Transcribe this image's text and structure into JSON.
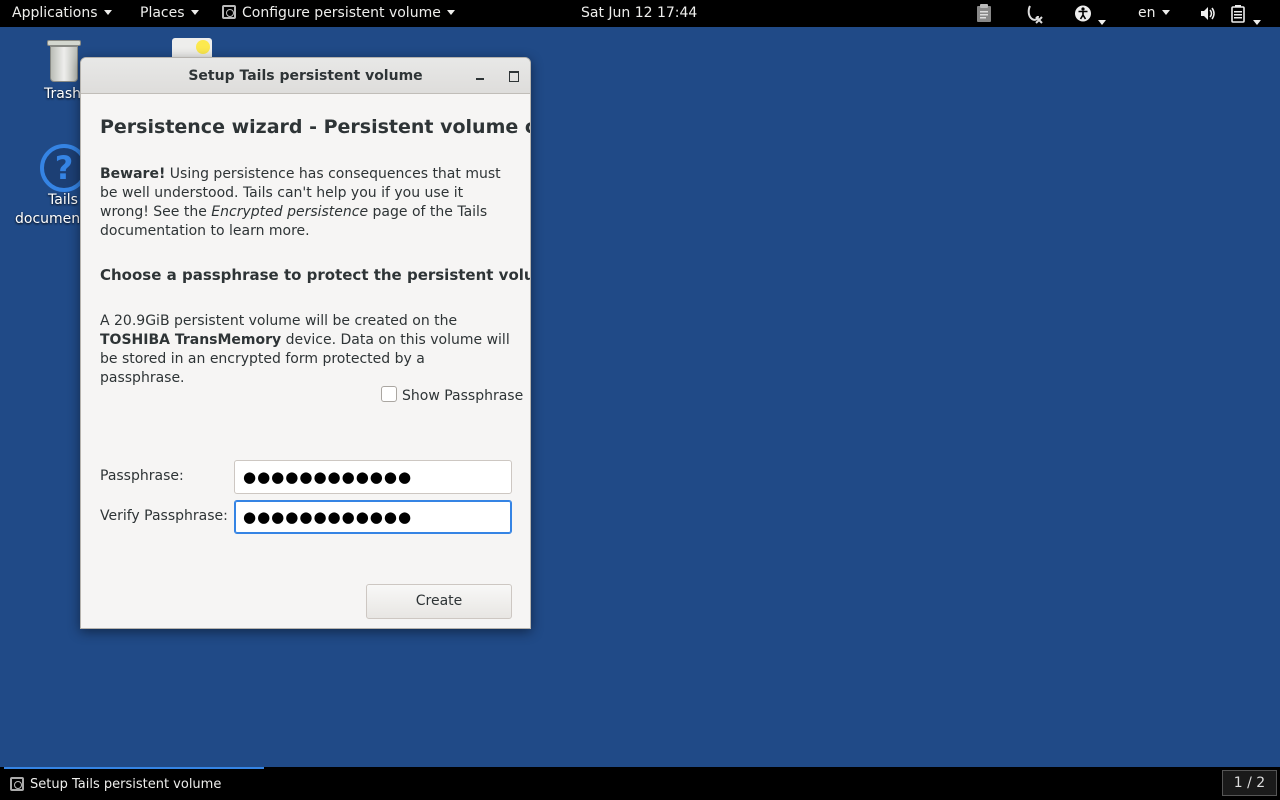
{
  "topbar": {
    "applications": "Applications",
    "places": "Places",
    "active_app": "Configure persistent volume",
    "datetime": "Sat Jun 12  17:44",
    "language": "en"
  },
  "desktop": {
    "trash_label": "Trash",
    "help_label_line1": "Tails",
    "help_label_line2": "documentation"
  },
  "window": {
    "title": "Setup Tails persistent volume",
    "heading": "Persistence wizard - Persistent volume creation",
    "warning_bold": "Beware!",
    "warning_text1": " Using persistence has consequences that must be well understood. Tails can't help you if you use it wrong! See the ",
    "warning_italic": "Encrypted persistence",
    "warning_text2": " page of the Tails documentation to learn more.",
    "subheading": "Choose a passphrase to protect the persistent volume",
    "desc_text1": "A 20.9GiB persistent volume will be created on the ",
    "desc_device": "TOSHIBA TransMemory",
    "desc_text2": " device. Data on this volume will be stored in an encrypted form protected by a passphrase.",
    "show_passphrase_label": "Show Passphrase",
    "show_passphrase_checked": false,
    "passphrase_label": "Passphrase:",
    "passphrase_value": "●●●●●●●●●●●●",
    "verify_label": "Verify Passphrase:",
    "verify_value": "●●●●●●●●●●●●",
    "create_button": "Create"
  },
  "taskbar": {
    "window_item": "Setup Tails persistent volume",
    "workspace": "1 / 2"
  },
  "colors": {
    "desktop_bg": "#204a87",
    "focus_accent": "#3584e4"
  }
}
